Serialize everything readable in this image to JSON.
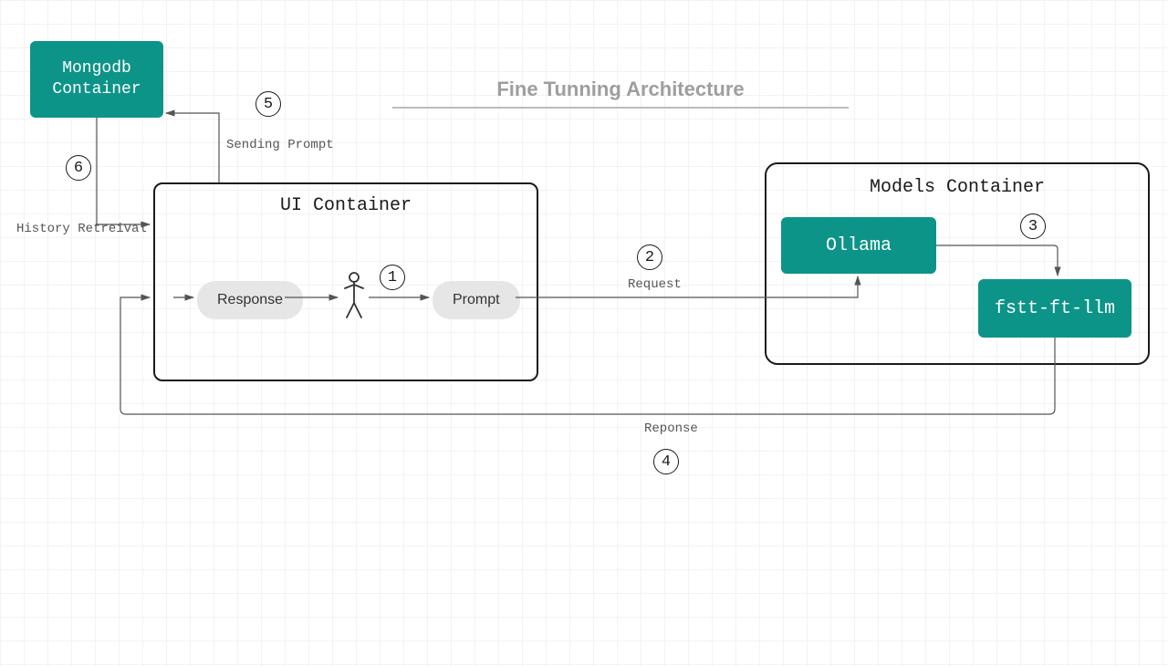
{
  "title": "Fine Tunning Architecture",
  "nodes": {
    "mongodb": "Mongodb\nContainer",
    "ui_container": "UI Container",
    "models_container": "Models Container",
    "ollama": "Ollama",
    "fstt": "fstt-ft-llm",
    "response_pill": "Response",
    "prompt_pill": "Prompt"
  },
  "badges": {
    "b1": "1",
    "b2": "2",
    "b3": "3",
    "b4": "4",
    "b5": "5",
    "b6": "6"
  },
  "labels": {
    "sending_prompt": "Sending Prompt",
    "history_retrieval": "History Retreival",
    "request": "Request",
    "response": "Reponse"
  }
}
